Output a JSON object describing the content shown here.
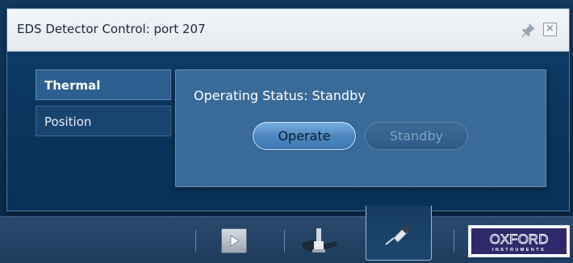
{
  "window": {
    "title": "EDS Detector Control: port 207"
  },
  "tabs": [
    {
      "label": "Thermal",
      "selected": true
    },
    {
      "label": "Position",
      "selected": false
    }
  ],
  "popup": {
    "status_text": "Operating Status: Standby",
    "operate_label": "Operate",
    "standby_label": "Standby",
    "standby_enabled": false
  },
  "toolbar": {
    "items": [
      {
        "icon": "play-icon"
      },
      {
        "icon": "stage-icon"
      },
      {
        "icon": "detector-icon",
        "selected": true
      }
    ],
    "logo_text": "OXFORD INSTRUMENTS"
  },
  "colors": {
    "panel_bg": "#0c3760",
    "popup_bg": "#3a6a98",
    "titlebar_bg": "#eef1f5",
    "accent_button": "#4d87c0"
  }
}
